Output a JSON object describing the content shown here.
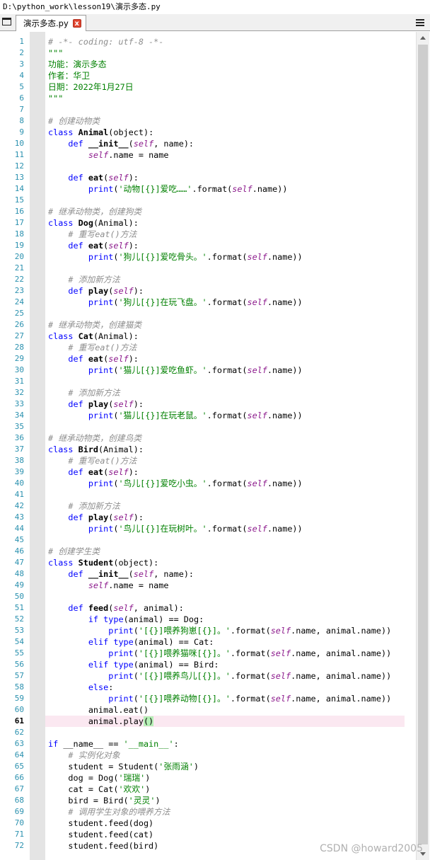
{
  "window": {
    "title": "D:\\python_work\\lesson19\\演示多态.py"
  },
  "tab": {
    "label": "演示多态.py",
    "close": "x"
  },
  "watermark": "CSDN @howard2005",
  "current_line": 61,
  "code_lines": [
    [
      [
        "cm",
        "# -*- coding: utf-8 -*-"
      ]
    ],
    [
      [
        "str",
        "\"\"\""
      ]
    ],
    [
      [
        "str",
        "功能：演示多态"
      ]
    ],
    [
      [
        "str",
        "作者：华卫"
      ]
    ],
    [
      [
        "str",
        "日期：2022年1月27日"
      ]
    ],
    [
      [
        "str",
        "\"\"\""
      ]
    ],
    [],
    [
      [
        "cm",
        "# 创建动物类"
      ]
    ],
    [
      [
        "kw",
        "class "
      ],
      [
        "def",
        "Animal"
      ],
      [
        "",
        "(object):"
      ]
    ],
    [
      [
        "",
        "    "
      ],
      [
        "kw",
        "def "
      ],
      [
        "def",
        "__init__"
      ],
      [
        "",
        "("
      ],
      [
        "slf",
        "self"
      ],
      [
        "",
        ", name):"
      ]
    ],
    [
      [
        "",
        "        "
      ],
      [
        "slf",
        "self"
      ],
      [
        "",
        ".name = name"
      ]
    ],
    [],
    [
      [
        "",
        "    "
      ],
      [
        "kw",
        "def "
      ],
      [
        "def",
        "eat"
      ],
      [
        "",
        "("
      ],
      [
        "slf",
        "self"
      ],
      [
        "",
        "):"
      ]
    ],
    [
      [
        "",
        "        "
      ],
      [
        "kw",
        "print"
      ],
      [
        "",
        "("
      ],
      [
        "str",
        "'动物[{}]爱吃……'"
      ],
      [
        "",
        ".format("
      ],
      [
        "slf",
        "self"
      ],
      [
        "",
        ".name))"
      ]
    ],
    [],
    [
      [
        "cm",
        "# 继承动物类，创建狗类"
      ]
    ],
    [
      [
        "kw",
        "class "
      ],
      [
        "def",
        "Dog"
      ],
      [
        "",
        "(Animal):"
      ]
    ],
    [
      [
        "",
        "    "
      ],
      [
        "cm",
        "# 重写eat()方法"
      ]
    ],
    [
      [
        "",
        "    "
      ],
      [
        "kw",
        "def "
      ],
      [
        "def",
        "eat"
      ],
      [
        "",
        "("
      ],
      [
        "slf",
        "self"
      ],
      [
        "",
        "):"
      ]
    ],
    [
      [
        "",
        "        "
      ],
      [
        "kw",
        "print"
      ],
      [
        "",
        "("
      ],
      [
        "str",
        "'狗儿[{}]爱吃骨头。'"
      ],
      [
        "",
        ".format("
      ],
      [
        "slf",
        "self"
      ],
      [
        "",
        ".name))"
      ]
    ],
    [],
    [
      [
        "",
        "    "
      ],
      [
        "cm",
        "# 添加新方法"
      ]
    ],
    [
      [
        "",
        "    "
      ],
      [
        "kw",
        "def "
      ],
      [
        "def",
        "play"
      ],
      [
        "",
        "("
      ],
      [
        "slf",
        "self"
      ],
      [
        "",
        "):"
      ]
    ],
    [
      [
        "",
        "        "
      ],
      [
        "kw",
        "print"
      ],
      [
        "",
        "("
      ],
      [
        "str",
        "'狗儿[{}]在玩飞盘。'"
      ],
      [
        "",
        ".format("
      ],
      [
        "slf",
        "self"
      ],
      [
        "",
        ".name))"
      ]
    ],
    [],
    [
      [
        "cm",
        "# 继承动物类，创建猫类"
      ]
    ],
    [
      [
        "kw",
        "class "
      ],
      [
        "def",
        "Cat"
      ],
      [
        "",
        "(Animal):"
      ]
    ],
    [
      [
        "",
        "    "
      ],
      [
        "cm",
        "# 重写eat()方法"
      ]
    ],
    [
      [
        "",
        "    "
      ],
      [
        "kw",
        "def "
      ],
      [
        "def",
        "eat"
      ],
      [
        "",
        "("
      ],
      [
        "slf",
        "self"
      ],
      [
        "",
        "):"
      ]
    ],
    [
      [
        "",
        "        "
      ],
      [
        "kw",
        "print"
      ],
      [
        "",
        "("
      ],
      [
        "str",
        "'猫儿[{}]爱吃鱼虾。'"
      ],
      [
        "",
        ".format("
      ],
      [
        "slf",
        "self"
      ],
      [
        "",
        ".name))"
      ]
    ],
    [],
    [
      [
        "",
        "    "
      ],
      [
        "cm",
        "# 添加新方法"
      ]
    ],
    [
      [
        "",
        "    "
      ],
      [
        "kw",
        "def "
      ],
      [
        "def",
        "play"
      ],
      [
        "",
        "("
      ],
      [
        "slf",
        "self"
      ],
      [
        "",
        "):"
      ]
    ],
    [
      [
        "",
        "        "
      ],
      [
        "kw",
        "print"
      ],
      [
        "",
        "("
      ],
      [
        "str",
        "'猫儿[{}]在玩老鼠。'"
      ],
      [
        "",
        ".format("
      ],
      [
        "slf",
        "self"
      ],
      [
        "",
        ".name))"
      ]
    ],
    [],
    [
      [
        "cm",
        "# 继承动物类，创建鸟类"
      ]
    ],
    [
      [
        "kw",
        "class "
      ],
      [
        "def",
        "Bird"
      ],
      [
        "",
        "(Animal):"
      ]
    ],
    [
      [
        "",
        "    "
      ],
      [
        "cm",
        "# 重写eat()方法"
      ]
    ],
    [
      [
        "",
        "    "
      ],
      [
        "kw",
        "def "
      ],
      [
        "def",
        "eat"
      ],
      [
        "",
        "("
      ],
      [
        "slf",
        "self"
      ],
      [
        "",
        "):"
      ]
    ],
    [
      [
        "",
        "        "
      ],
      [
        "kw",
        "print"
      ],
      [
        "",
        "("
      ],
      [
        "str",
        "'鸟儿[{}]爱吃小虫。'"
      ],
      [
        "",
        ".format("
      ],
      [
        "slf",
        "self"
      ],
      [
        "",
        ".name))"
      ]
    ],
    [],
    [
      [
        "",
        "    "
      ],
      [
        "cm",
        "# 添加新方法"
      ]
    ],
    [
      [
        "",
        "    "
      ],
      [
        "kw",
        "def "
      ],
      [
        "def",
        "play"
      ],
      [
        "",
        "("
      ],
      [
        "slf",
        "self"
      ],
      [
        "",
        "):"
      ]
    ],
    [
      [
        "",
        "        "
      ],
      [
        "kw",
        "print"
      ],
      [
        "",
        "("
      ],
      [
        "str",
        "'鸟儿[{}]在玩树叶。'"
      ],
      [
        "",
        ".format("
      ],
      [
        "slf",
        "self"
      ],
      [
        "",
        ".name))"
      ]
    ],
    [],
    [
      [
        "cm",
        "# 创建学生类"
      ]
    ],
    [
      [
        "kw",
        "class "
      ],
      [
        "def",
        "Student"
      ],
      [
        "",
        "(object):"
      ]
    ],
    [
      [
        "",
        "    "
      ],
      [
        "kw",
        "def "
      ],
      [
        "def",
        "__init__"
      ],
      [
        "",
        "("
      ],
      [
        "slf",
        "self"
      ],
      [
        "",
        ", name):"
      ]
    ],
    [
      [
        "",
        "        "
      ],
      [
        "slf",
        "self"
      ],
      [
        "",
        ".name = name"
      ]
    ],
    [],
    [
      [
        "",
        "    "
      ],
      [
        "kw",
        "def "
      ],
      [
        "def",
        "feed"
      ],
      [
        "",
        "("
      ],
      [
        "slf",
        "self"
      ],
      [
        "",
        ", animal):"
      ]
    ],
    [
      [
        "",
        "        "
      ],
      [
        "kw",
        "if "
      ],
      [
        "kw",
        "type"
      ],
      [
        "",
        "(animal) == Dog:"
      ]
    ],
    [
      [
        "",
        "            "
      ],
      [
        "kw",
        "print"
      ],
      [
        "",
        "("
      ],
      [
        "str",
        "'[{}]喂养狗崽[{}]。'"
      ],
      [
        "",
        ".format("
      ],
      [
        "slf",
        "self"
      ],
      [
        "",
        ".name, animal.name))"
      ]
    ],
    [
      [
        "",
        "        "
      ],
      [
        "kw",
        "elif "
      ],
      [
        "kw",
        "type"
      ],
      [
        "",
        "(animal) == Cat:"
      ]
    ],
    [
      [
        "",
        "            "
      ],
      [
        "kw",
        "print"
      ],
      [
        "",
        "("
      ],
      [
        "str",
        "'[{}]喂养猫咪[{}]。'"
      ],
      [
        "",
        ".format("
      ],
      [
        "slf",
        "self"
      ],
      [
        "",
        ".name, animal.name))"
      ]
    ],
    [
      [
        "",
        "        "
      ],
      [
        "kw",
        "elif "
      ],
      [
        "kw",
        "type"
      ],
      [
        "",
        "(animal) == Bird:"
      ]
    ],
    [
      [
        "",
        "            "
      ],
      [
        "kw",
        "print"
      ],
      [
        "",
        "("
      ],
      [
        "str",
        "'[{}]喂养鸟儿[{}]。'"
      ],
      [
        "",
        ".format("
      ],
      [
        "slf",
        "self"
      ],
      [
        "",
        ".name, animal.name))"
      ]
    ],
    [
      [
        "",
        "        "
      ],
      [
        "kw",
        "else"
      ],
      [
        "",
        ":"
      ]
    ],
    [
      [
        "",
        "            "
      ],
      [
        "kw",
        "print"
      ],
      [
        "",
        "("
      ],
      [
        "str",
        "'[{}]喂养动物[{}]。'"
      ],
      [
        "",
        ".format("
      ],
      [
        "slf",
        "self"
      ],
      [
        "",
        ".name, animal.name))"
      ]
    ],
    [
      [
        "",
        "        animal.eat()"
      ]
    ],
    [
      [
        "",
        "        animal.play"
      ],
      [
        "brk",
        "()"
      ]
    ],
    [],
    [
      [
        "kw",
        "if "
      ],
      [
        "",
        "__name__ == "
      ],
      [
        "str",
        "'__main__'"
      ],
      [
        "",
        ":"
      ]
    ],
    [
      [
        "",
        "    "
      ],
      [
        "cm",
        "# 实例化对象"
      ]
    ],
    [
      [
        "",
        "    student = Student("
      ],
      [
        "str",
        "'张雨涵'"
      ],
      [
        "",
        ")"
      ]
    ],
    [
      [
        "",
        "    dog = Dog("
      ],
      [
        "str",
        "'瑞瑞'"
      ],
      [
        "",
        ")"
      ]
    ],
    [
      [
        "",
        "    cat = Cat("
      ],
      [
        "str",
        "'欢欢'"
      ],
      [
        "",
        ")"
      ]
    ],
    [
      [
        "",
        "    bird = Bird("
      ],
      [
        "str",
        "'灵灵'"
      ],
      [
        "",
        ")"
      ]
    ],
    [
      [
        "",
        "    "
      ],
      [
        "cm",
        "# 调用学生对象的喂养方法"
      ]
    ],
    [
      [
        "",
        "    student.feed(dog)"
      ]
    ],
    [
      [
        "",
        "    student.feed(cat)"
      ]
    ],
    [
      [
        "",
        "    student.feed(bird)"
      ]
    ]
  ]
}
